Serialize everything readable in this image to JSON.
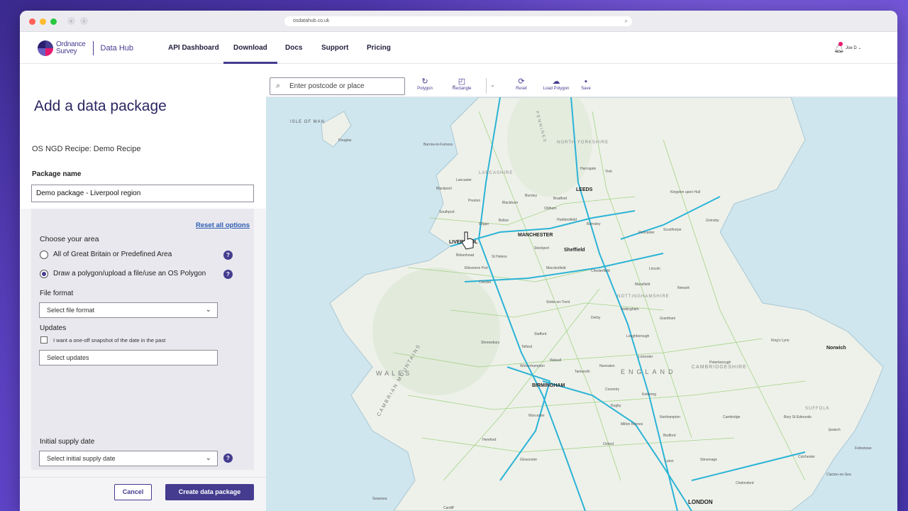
{
  "browser": {
    "url": "osdatahub.co.uk"
  },
  "brand": {
    "logo_line1": "Ordnance",
    "logo_line2": "Survey",
    "product": "Data Hub"
  },
  "nav": {
    "items": [
      {
        "label": "API Dashboard"
      },
      {
        "label": "Download"
      },
      {
        "label": "Docs"
      },
      {
        "label": "Support"
      },
      {
        "label": "Pricing"
      }
    ],
    "active": "Download",
    "notification_count": "1",
    "user": "Joe D"
  },
  "panel": {
    "title": "Add a data package",
    "recipe": "OS NGD Recipe: Demo Recipe",
    "package_name_label": "Package name",
    "package_name_value": "Demo package - Liverpool region",
    "reset_label": "Reset all options",
    "choose_area_label": "Choose your area",
    "area_options": [
      {
        "label": "All of Great Britain or Predefined Area",
        "selected": false
      },
      {
        "label": "Draw a polygon/upload a file/use an OS Polygon",
        "selected": true
      }
    ],
    "file_format_label": "File format",
    "file_format_placeholder": "Select file format",
    "updates_label": "Updates",
    "snapshot_checkbox_label": "I want a one-off snapshot of the date in the past",
    "updates_placeholder": "Select updates",
    "supply_date_label": "Initial supply date",
    "supply_date_placeholder": "Select initial supply date",
    "cancel_label": "Cancel",
    "create_label": "Create data package"
  },
  "toolbar": {
    "search_placeholder": "Enter postcode or place",
    "tools": [
      {
        "label": "Polygon",
        "icon": "polygon-icon"
      },
      {
        "label": "Rectangle",
        "icon": "rectangle-icon"
      },
      {
        "label": "Reset",
        "icon": "reset-icon"
      },
      {
        "label": "Load Polygon",
        "icon": "upload-icon"
      },
      {
        "label": "Save",
        "icon": "save-icon"
      }
    ]
  },
  "map": {
    "regions": [
      "ISLE OF MAN",
      "WALES",
      "ENGLAND",
      "CAMBRIAN MOUNTAINS",
      "LANCASHIRE",
      "NORTH YORKSHIRE",
      "PENNINES",
      "CAMBRIDGESHIRE",
      "NOTTINGHAMSHIRE",
      "SUFFOLK"
    ],
    "major_places": [
      "LIVERPOOL",
      "MANCHESTER",
      "LEEDS",
      "Sheffield",
      "BIRMINGHAM",
      "LONDON",
      "Norwich"
    ],
    "places": [
      "Douglas",
      "Barrow-in-Furness",
      "Lancaster",
      "Harrogate",
      "York",
      "Blackpool",
      "Preston",
      "Blackburn",
      "Burnley",
      "Bradford",
      "Hull",
      "Kingston upon Hull",
      "Southport",
      "Wigan",
      "Bolton",
      "Oldham",
      "Huddersfield",
      "Barnsley",
      "Doncaster",
      "Scunthorpe",
      "Grimsby",
      "St Helens",
      "Stockport",
      "Birkenhead",
      "Ellesmere Port",
      "Chester",
      "Macclesfield",
      "Chesterfield",
      "Lincoln",
      "Mansfield",
      "Newark",
      "Nottingham",
      "Stoke-on-Trent",
      "Derby",
      "Grantham",
      "Shrewsbury",
      "Telford",
      "Stafford",
      "Leicester",
      "Peterborough",
      "King's Lynn",
      "Wolverhampton",
      "Walsall",
      "Coventry",
      "Rugby",
      "Northampton",
      "Cambridge",
      "Bury St Edmunds",
      "Ipswich",
      "Worcester",
      "Hereford",
      "Gloucester",
      "Oxford",
      "Luton",
      "Colchester",
      "Swansea",
      "Cardiff",
      "Bedford",
      "Milton Keynes",
      "Stevenage",
      "Chelmsford",
      "Clacton-on-Sea",
      "Felixstowe",
      "Kettering",
      "Tamworth",
      "Nuneaton",
      "Loughborough",
      "Grimsby"
    ]
  },
  "colors": {
    "brand": "#453c90",
    "accent": "#e8196e",
    "link": "#2d5db3",
    "road": "#2bb3d6",
    "land": "#eef1ea",
    "sea": "#cfe6ef"
  }
}
